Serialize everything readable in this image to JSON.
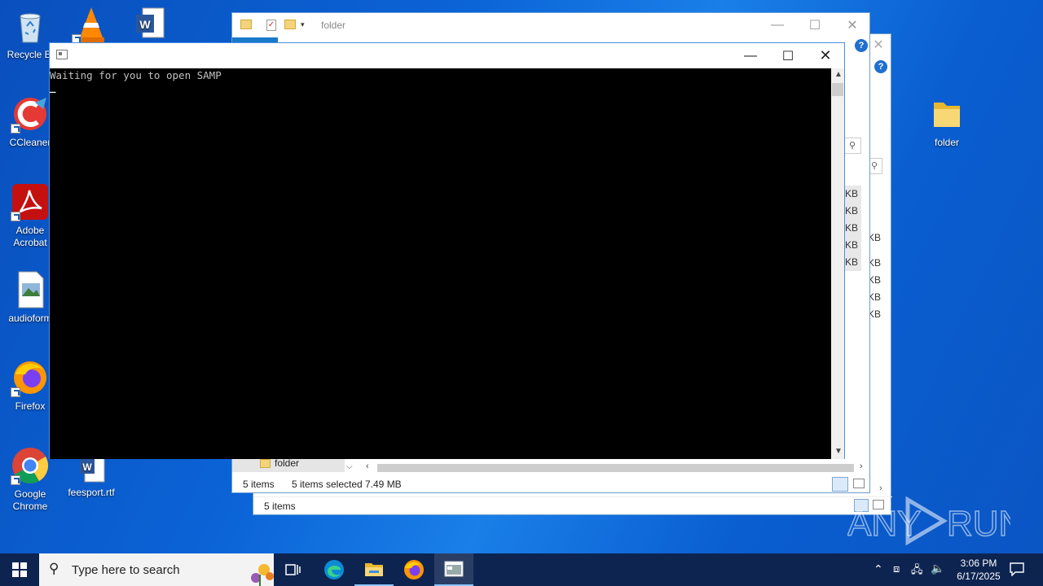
{
  "desktop": {
    "icons": [
      {
        "label": "Recycle Bi",
        "icon": "recycle-bin-icon"
      },
      {
        "label": "CCleaner",
        "icon": "ccleaner-icon"
      },
      {
        "label": "Adobe Acrobat",
        "icon": "acrobat-icon"
      },
      {
        "label": "audioform",
        "icon": "image-file-icon"
      },
      {
        "label": "Firefox",
        "icon": "firefox-icon"
      },
      {
        "label": "Google Chrome",
        "icon": "chrome-icon"
      },
      {
        "label": "feesport.rtf",
        "icon": "word-document-icon"
      },
      {
        "label": "folder",
        "icon": "folder-icon"
      }
    ]
  },
  "explorer_front": {
    "title": "folder",
    "nav_item": "folder",
    "status_items": "5 items",
    "status_selected": "5 items selected",
    "status_size": "7.49 MB",
    "size_cells": [
      "KB",
      "KB",
      "KB",
      "KB",
      "KB"
    ]
  },
  "explorer_back": {
    "status_items": "5 items",
    "size_cells": [
      "KB",
      "KB",
      "KB",
      "KB",
      "KB"
    ]
  },
  "console": {
    "output_line": "Waiting for you to open SAMP",
    "cursor": "_"
  },
  "taskbar": {
    "search_placeholder": "Type here to search",
    "time": "3:06 PM",
    "date": "6/17/2025"
  },
  "watermark": "ANY RUN",
  "colors": {
    "accent": "#0b63d6",
    "taskbar": "#0d2450",
    "console_bg": "#000000",
    "console_text": "#c0c0c0"
  }
}
